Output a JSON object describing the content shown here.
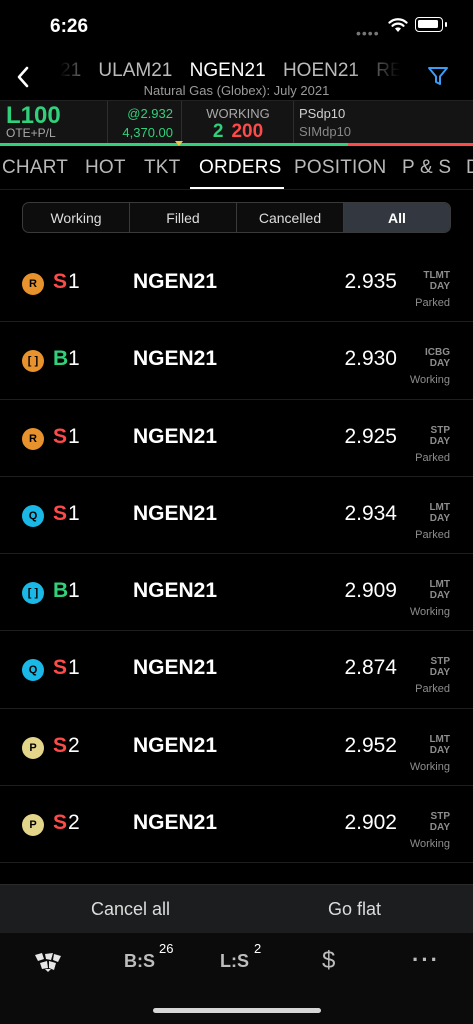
{
  "status_bar": {
    "time": "6:26"
  },
  "header": {
    "symbols": [
      "21",
      "ULAM21",
      "NGEN21",
      "HOEN21",
      "RE"
    ],
    "active_symbol_index": 2,
    "subtitle": "Natural Gas (Globex): July 2021",
    "icons": {
      "back": "chevron-left-icon",
      "filter": "funnel-icon"
    }
  },
  "account": {
    "name": "L100",
    "pl_label": "OTE+P/L",
    "price": "@2.932",
    "pl_value": "4,370.00",
    "working_label": "WORKING",
    "working_buy": "2",
    "working_sell": "200",
    "account_a": "PSdp10",
    "account_b": "SIMdp10",
    "colors": {
      "profit": "#31d07a",
      "loss": "#ff4a4a"
    }
  },
  "tabs": [
    "CHART",
    "HOT",
    "TKT",
    "ORDERS",
    "POSITION",
    "P & S",
    "D"
  ],
  "active_tab": "ORDERS",
  "filters": [
    "Working",
    "Filled",
    "Cancelled",
    "All"
  ],
  "active_filter": "All",
  "orders": [
    {
      "badge": "R",
      "badge_color": "orange",
      "side": "S",
      "qty": "1",
      "symbol": "NGEN21",
      "price": "2.935",
      "type": "TLMT",
      "tif": "DAY",
      "status": "Parked"
    },
    {
      "badge": "[ ]",
      "badge_color": "orange",
      "side": "B",
      "qty": "1",
      "symbol": "NGEN21",
      "price": "2.930",
      "type": "ICBG",
      "tif": "DAY",
      "status": "Working"
    },
    {
      "badge": "R",
      "badge_color": "orange",
      "side": "S",
      "qty": "1",
      "symbol": "NGEN21",
      "price": "2.925",
      "type": "STP",
      "tif": "DAY",
      "status": "Parked"
    },
    {
      "badge": "Q",
      "badge_color": "cyan",
      "side": "S",
      "qty": "1",
      "symbol": "NGEN21",
      "price": "2.934",
      "type": "LMT",
      "tif": "DAY",
      "status": "Parked"
    },
    {
      "badge": "[ ]",
      "badge_color": "cyan",
      "side": "B",
      "qty": "1",
      "symbol": "NGEN21",
      "price": "2.909",
      "type": "LMT",
      "tif": "DAY",
      "status": "Working"
    },
    {
      "badge": "Q",
      "badge_color": "cyan",
      "side": "S",
      "qty": "1",
      "symbol": "NGEN21",
      "price": "2.874",
      "type": "STP",
      "tif": "DAY",
      "status": "Parked"
    },
    {
      "badge": "P",
      "badge_color": "yellow",
      "side": "S",
      "qty": "2",
      "symbol": "NGEN21",
      "price": "2.952",
      "type": "LMT",
      "tif": "DAY",
      "status": "Working"
    },
    {
      "badge": "P",
      "badge_color": "yellow",
      "side": "S",
      "qty": "2",
      "symbol": "NGEN21",
      "price": "2.902",
      "type": "STP",
      "tif": "DAY",
      "status": "Working"
    }
  ],
  "actions": {
    "cancel_all": "Cancel all",
    "go_flat": "Go flat"
  },
  "tabbar": {
    "bs_label": "B:S",
    "bs_count": "26",
    "ls_label": "L:S",
    "ls_count": "2",
    "dollar": "$",
    "more": "···",
    "icons": {
      "home": "logo-icon",
      "more": "more-icon"
    }
  }
}
